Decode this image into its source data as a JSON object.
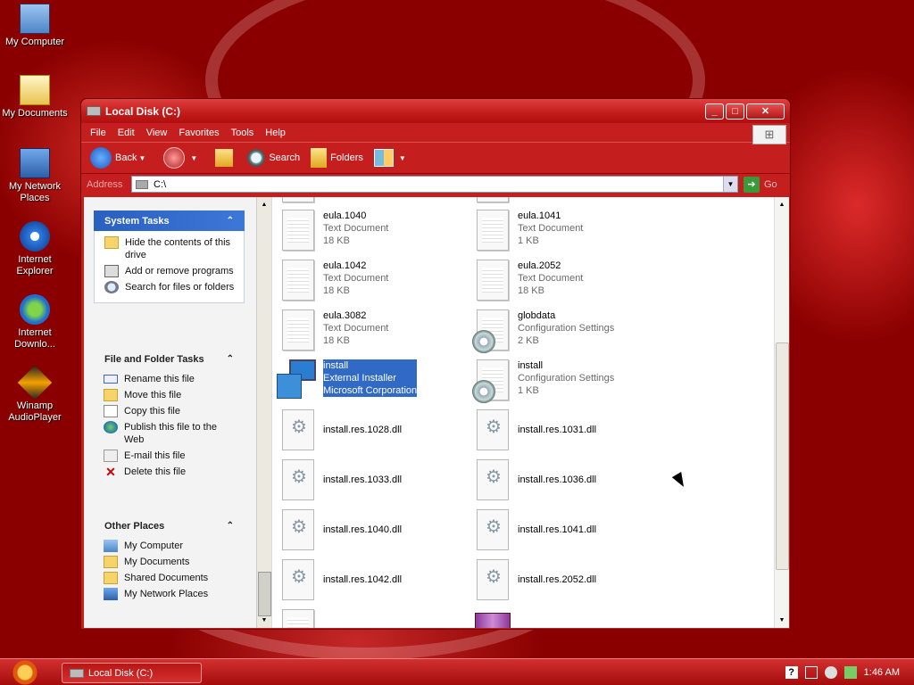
{
  "desktop_icons": [
    {
      "label": "My Computer",
      "icon": "my-computer-icon"
    },
    {
      "label": "My Documents",
      "icon": "my-documents-icon"
    },
    {
      "label": "My Network Places",
      "icon": "network-places-icon"
    },
    {
      "label": "Internet Explorer",
      "icon": "internet-explorer-icon"
    },
    {
      "label": "Internet Downlo...",
      "icon": "download-manager-icon"
    },
    {
      "label": "Winamp AudioPlayer",
      "icon": "winamp-icon"
    }
  ],
  "window": {
    "title": "Local Disk (C:)",
    "menu": [
      "File",
      "Edit",
      "View",
      "Favorites",
      "Tools",
      "Help"
    ],
    "toolbar": {
      "back": "Back",
      "search": "Search",
      "folders": "Folders"
    },
    "address": {
      "label": "Address",
      "value": "C:\\",
      "go": "Go"
    }
  },
  "taskpane": {
    "system_tasks": {
      "title": "System Tasks",
      "items": [
        "Hide the contents of this drive",
        "Add or remove programs",
        "Search for files or folders"
      ]
    },
    "file_folder_tasks": {
      "title": "File and Folder Tasks",
      "items": [
        "Rename this file",
        "Move this file",
        "Copy this file",
        "Publish this file to the Web",
        "E-mail this file",
        "Delete this file"
      ]
    },
    "other_places": {
      "title": "Other Places",
      "items": [
        "My Computer",
        "My Documents",
        "Shared Documents",
        "My Network Places"
      ]
    }
  },
  "files": [
    {
      "name": "eula.1040",
      "type": "Text Document",
      "size": "18 KB",
      "kind": "doc"
    },
    {
      "name": "eula.1041",
      "type": "Text Document",
      "size": "1 KB",
      "kind": "doc"
    },
    {
      "name": "eula.1042",
      "type": "Text Document",
      "size": "18 KB",
      "kind": "doc"
    },
    {
      "name": "eula.2052",
      "type": "Text Document",
      "size": "18 KB",
      "kind": "doc"
    },
    {
      "name": "eula.3082",
      "type": "Text Document",
      "size": "18 KB",
      "kind": "doc"
    },
    {
      "name": "globdata",
      "type": "Configuration Settings",
      "size": "2 KB",
      "kind": "cfg"
    },
    {
      "name": "install",
      "type": "External Installer",
      "size": "Microsoft Corporation",
      "kind": "msi",
      "selected": true
    },
    {
      "name": "install",
      "type": "Configuration Settings",
      "size": "1 KB",
      "kind": "cfg"
    },
    {
      "name": "install.res.1028.dll",
      "kind": "dll"
    },
    {
      "name": "install.res.1031.dll",
      "kind": "dll"
    },
    {
      "name": "install.res.1033.dll",
      "kind": "dll"
    },
    {
      "name": "install.res.1036.dll",
      "kind": "dll"
    },
    {
      "name": "install.res.1040.dll",
      "kind": "dll"
    },
    {
      "name": "install.res.1041.dll",
      "kind": "dll"
    },
    {
      "name": "install.res.1042.dll",
      "kind": "dll"
    },
    {
      "name": "install.res.2052.dll",
      "kind": "dll"
    }
  ],
  "taskbar": {
    "task_label": "Local Disk (C:)",
    "clock": "1:46 AM"
  }
}
